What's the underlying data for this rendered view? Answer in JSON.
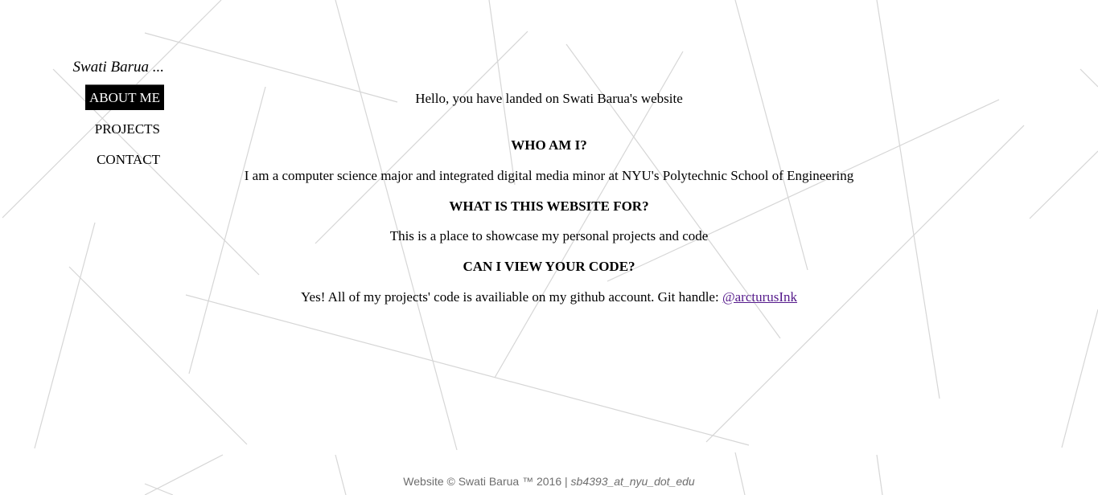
{
  "nav": {
    "name": "Swati Barua ...",
    "items": [
      {
        "label": "ABOUT ME"
      },
      {
        "label": "PROJECTS"
      },
      {
        "label": "CONTACT"
      }
    ]
  },
  "main": {
    "intro": "Hello, you have landed on Swati Barua's website",
    "sections": [
      {
        "heading": "WHO AM I?",
        "text": "I am a computer science major and integrated digital media minor at NYU's Polytechnic School of Engineering"
      },
      {
        "heading": "WHAT IS THIS WEBSITE FOR?",
        "text": "This is a place to showcase my personal projects and code"
      },
      {
        "heading": "CAN I VIEW YOUR CODE?",
        "text": "Yes! All of my projects' code is availiable on my github account. Git handle: ",
        "link": "@arcturusInk"
      }
    ]
  },
  "footer": {
    "copyright": "Website © Swati Barua ™ 2016 | ",
    "email": "sb4393_at_nyu_dot_edu"
  },
  "colors": {
    "background": "#ffffff",
    "lines": "#d6d6d6",
    "link": "#551a8b",
    "footer_text": "#6d6d6d",
    "active_nav_bg": "#000000"
  }
}
